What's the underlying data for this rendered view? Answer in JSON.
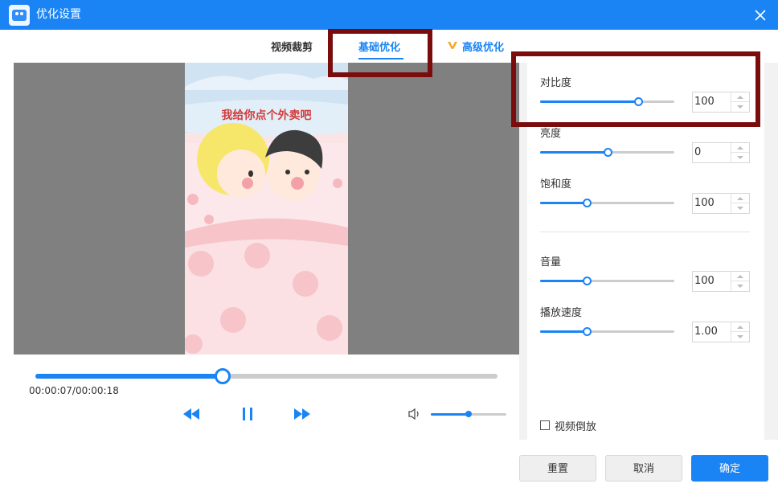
{
  "window": {
    "title": "优化设置"
  },
  "tabs": [
    {
      "label": "视频裁剪"
    },
    {
      "label": "基础优化",
      "active": true
    },
    {
      "label": "高级优化",
      "vip": true
    }
  ],
  "preview": {
    "caption": "我给你点个外卖吧"
  },
  "player": {
    "current_time": "00:00:07",
    "total_time": "00:00:18",
    "timecode": "00:00:07/00:00:18",
    "progress_fraction": 0.405,
    "volume_fraction": 0.5
  },
  "settings": [
    {
      "label": "对比度",
      "value": "100",
      "fraction": 0.73
    },
    {
      "label": "亮度",
      "value": "0",
      "fraction": 0.5
    },
    {
      "label": "饱和度",
      "value": "100",
      "fraction": 0.35
    },
    {
      "label": "音量",
      "value": "100",
      "fraction": 0.35
    },
    {
      "label": "播放速度",
      "value": "1.00",
      "fraction": 0.35
    }
  ],
  "reverse": {
    "label": "视频倒放",
    "checked": false
  },
  "buttons": {
    "reset": "重置",
    "cancel": "取消",
    "ok": "确定"
  },
  "colors": {
    "accent": "#1a84f5",
    "highlight": "#7b0c0c",
    "preview_bg": "#808080"
  }
}
